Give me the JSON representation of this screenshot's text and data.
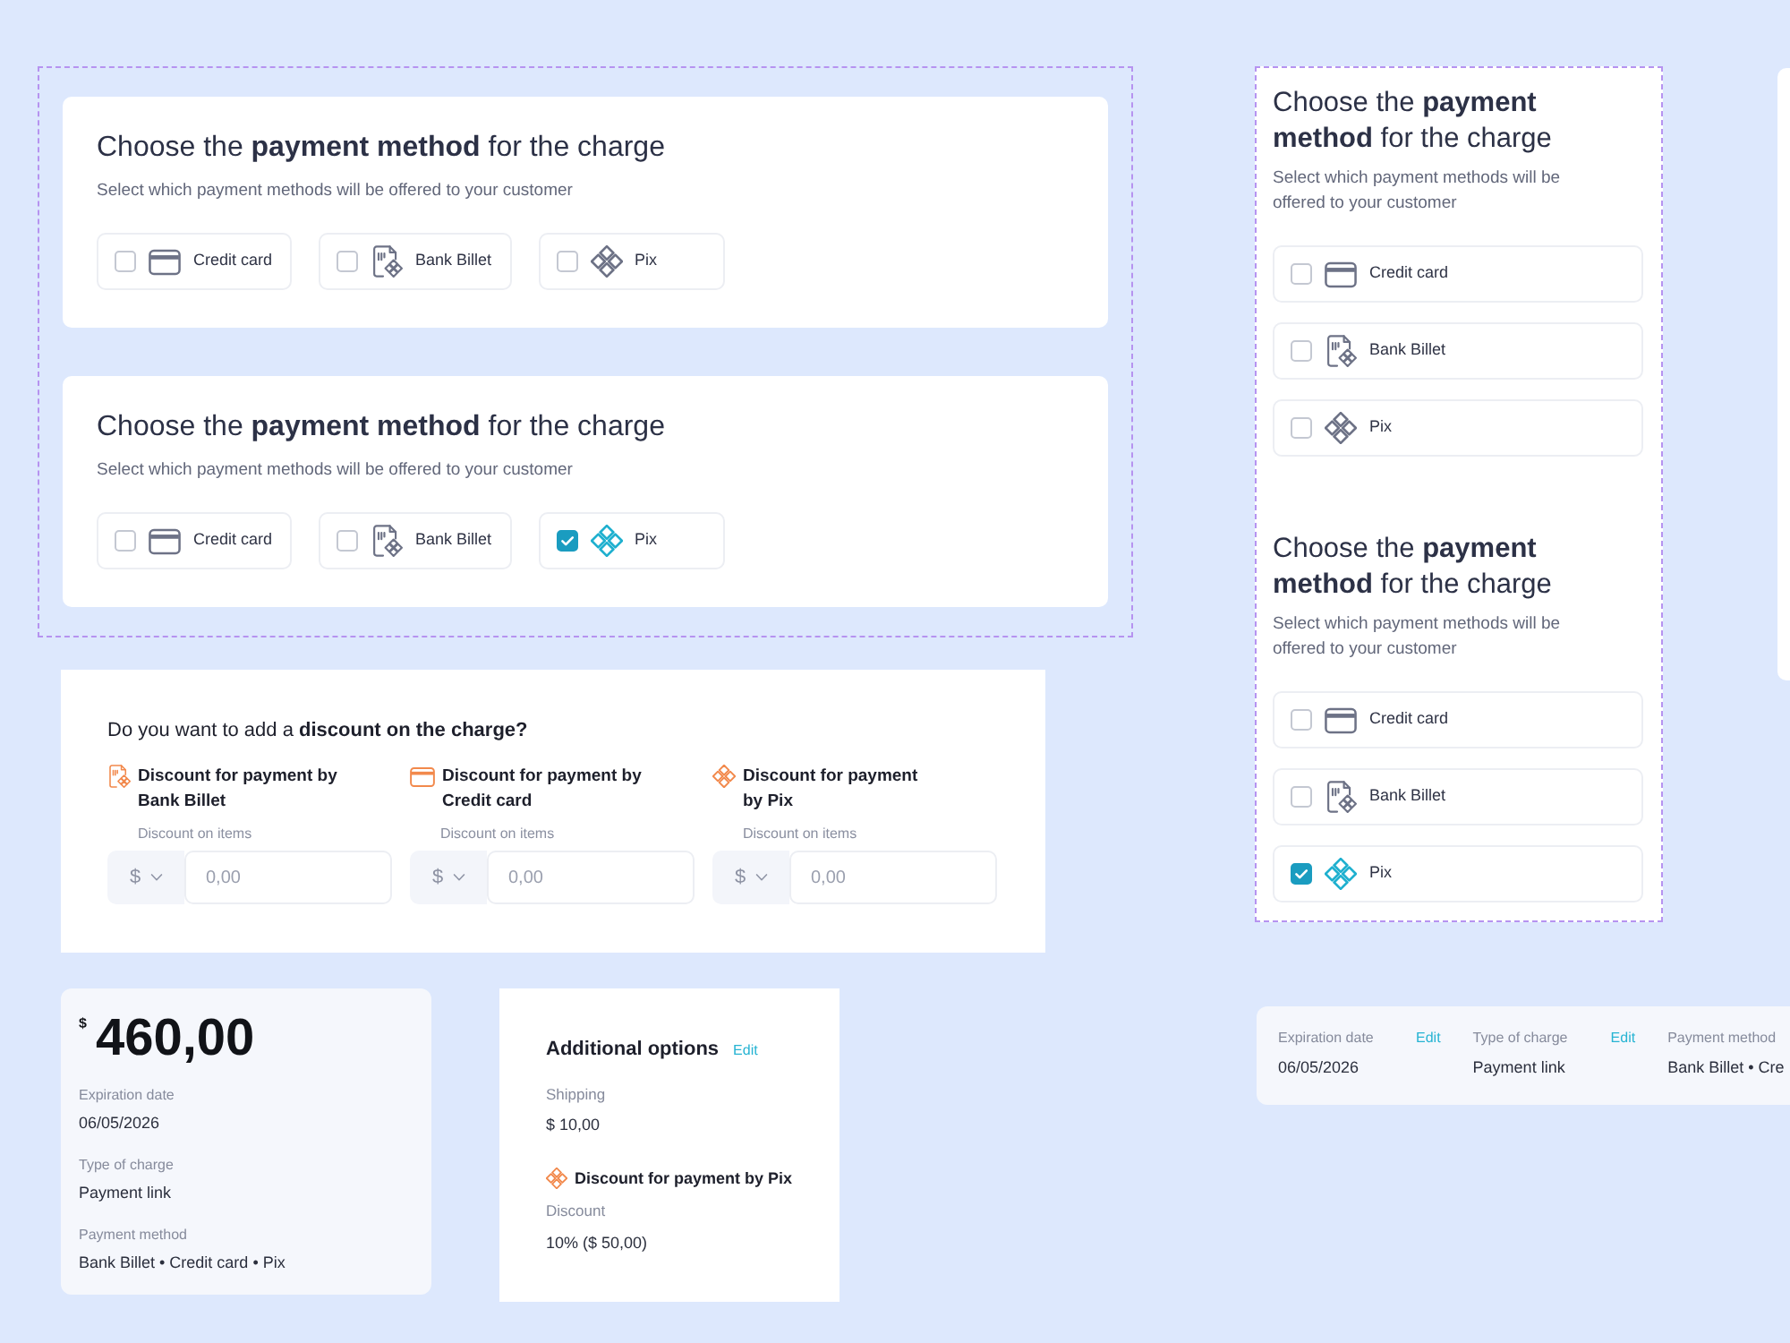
{
  "horizontal_group": {
    "cards": [
      {
        "title": "Choose the **payment method** for the charge",
        "subtitle": "Select which payment methods will be offered to your customer",
        "options": [
          {
            "kind": "credit_card",
            "label": "Credit card",
            "checked": false
          },
          {
            "kind": "bank_billet",
            "label": "Bank Billet",
            "checked": false
          },
          {
            "kind": "pix",
            "label": "Pix",
            "checked": false
          }
        ]
      },
      {
        "title": "Choose the **payment method** for the charge",
        "subtitle": "Select which payment methods will be offered to your customer",
        "options": [
          {
            "kind": "credit_card",
            "label": "Credit card",
            "checked": false
          },
          {
            "kind": "bank_billet",
            "label": "Bank Billet",
            "checked": false
          },
          {
            "kind": "pix",
            "label": "Pix",
            "checked": true
          }
        ]
      }
    ]
  },
  "discount_card": {
    "title": "Do you want to add a **discount on the charge?**",
    "items": [
      {
        "kind": "bank_billet",
        "title": "Discount for payment by Bank Billet",
        "field_label": "Discount on items",
        "currency": "$",
        "placeholder": "0,00"
      },
      {
        "kind": "credit_card",
        "title": "Discount for payment by Credit card",
        "field_label": "Discount on items",
        "currency": "$",
        "placeholder": "0,00"
      },
      {
        "kind": "pix",
        "title": "Discount for payment by Pix",
        "field_label": "Discount on items",
        "currency": "$",
        "placeholder": "0,00"
      }
    ]
  },
  "charge_summary": {
    "currency": "$",
    "amount": "460,00",
    "fields": [
      {
        "label": "Expiration date",
        "value": "06/05/2026"
      },
      {
        "label": "Type of charge",
        "value": "Payment link"
      },
      {
        "label": "Payment method",
        "value": "Bank Billet • Credit card • Pix"
      }
    ]
  },
  "additional_options": {
    "title": "Additional options",
    "edit_link": "Edit",
    "shipping": {
      "label": "Shipping",
      "value": "$ 10,00"
    },
    "discount": {
      "kind": "pix",
      "title": "Discount for payment by Pix",
      "label": "Discount",
      "value": "10% ($ 50,00)"
    }
  },
  "vertical_group": {
    "cards": [
      {
        "title": "Choose the **payment method** for the charge",
        "subtitle": "Select which payment methods will be offered to your customer",
        "options": [
          {
            "kind": "credit_card",
            "label": "Credit card",
            "checked": false
          },
          {
            "kind": "bank_billet",
            "label": "Bank Billet",
            "checked": false
          },
          {
            "kind": "pix",
            "label": "Pix",
            "checked": false
          }
        ]
      },
      {
        "title": "Choose the **payment method** for the charge",
        "subtitle": "Select which payment methods will be offered to your customer",
        "options": [
          {
            "kind": "credit_card",
            "label": "Credit card",
            "checked": false
          },
          {
            "kind": "bank_billet",
            "label": "Bank Billet",
            "checked": false
          },
          {
            "kind": "pix",
            "label": "Pix",
            "checked": true
          }
        ]
      }
    ]
  },
  "summary_bar": {
    "fields": [
      {
        "label": "Expiration date",
        "edit_link": "Edit",
        "value": "06/05/2026"
      },
      {
        "label": "Type of charge",
        "edit_link": "Edit",
        "value": "Payment link"
      },
      {
        "label": "Payment method",
        "value": "Bank Billet • Cre"
      }
    ]
  }
}
